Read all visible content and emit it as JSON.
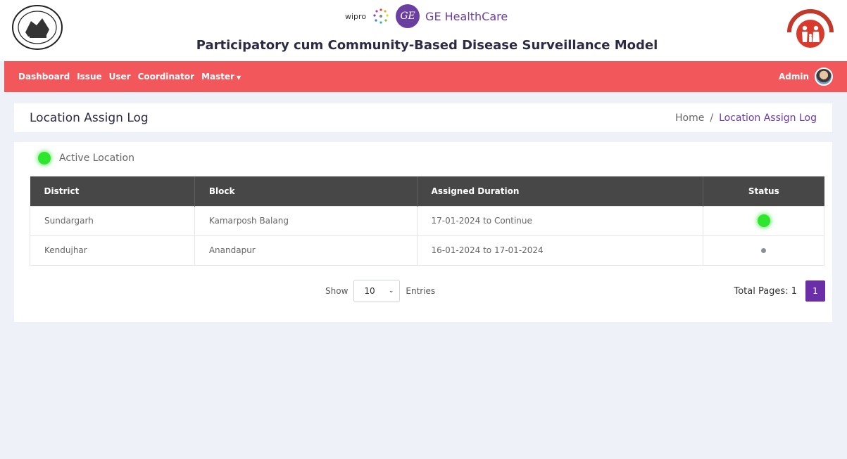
{
  "header": {
    "sponsor_left": "wipro",
    "sponsor_ge_mark": "GE",
    "sponsor_right": "GE HealthCare",
    "app_title": "Participatory cum Community-Based Disease Surveillance Model",
    "left_emblem_icon": "odisha-govt-emblem-icon",
    "right_emblem_icon": "national-health-mission-logo-icon"
  },
  "nav": {
    "items": [
      "Dashboard",
      "Issue",
      "User",
      "Coordinator",
      "Master"
    ],
    "user_label": "Admin",
    "bg_color": "#f2585b"
  },
  "page": {
    "title": "Location Assign Log",
    "breadcrumb_home": "Home",
    "breadcrumb_sep": "/",
    "breadcrumb_current": "Location Assign Log"
  },
  "legend": {
    "label": "Active Location"
  },
  "table": {
    "headers": [
      "District",
      "Block",
      "Assigned Duration",
      "Status"
    ],
    "rows": [
      {
        "district": "Sundargarh",
        "block": "Kamarposh Balang",
        "duration": "17-01-2024 to Continue",
        "status": "active"
      },
      {
        "district": "Kendujhar",
        "block": "Anandapur",
        "duration": "16-01-2024 to 17-01-2024",
        "status": "inactive"
      }
    ]
  },
  "pagination": {
    "show_label": "Show",
    "page_size": "10",
    "entries_label": "Entries",
    "total_pages_label": "Total Pages: 1",
    "current_page": "1"
  },
  "colors": {
    "accent": "#6a2fa8",
    "active_status": "#2ee62e",
    "inactive_status": "#8a8f9c"
  }
}
